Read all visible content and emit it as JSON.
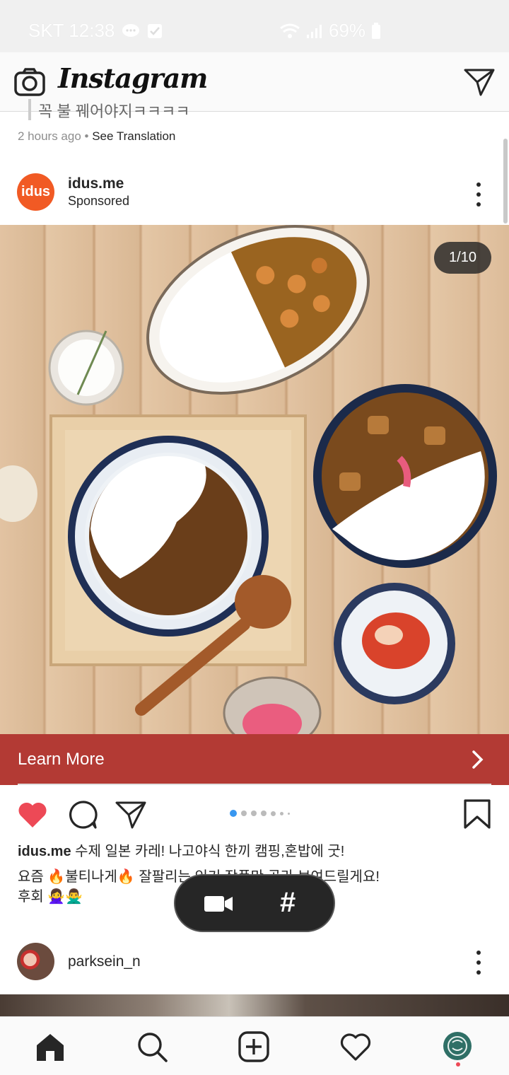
{
  "status_bar": {
    "carrier_time": "SKT 12:38",
    "battery": "69%",
    "icons": [
      "chat-bubble-icon",
      "check-square-icon",
      "wifi-icon",
      "signal-icon",
      "battery-icon"
    ]
  },
  "topbar": {
    "title": "Instagram",
    "camera_icon": "camera-icon",
    "direct_icon": "paper-plane-icon"
  },
  "previous_post": {
    "caption_partial": "꼭 불 꿰어야지ㅋㅋㅋㅋ",
    "time": "2 hours ago",
    "separator": "•",
    "see_translation": "See Translation"
  },
  "post": {
    "avatar_text": "idus",
    "username": "idus.me",
    "subtitle": "Sponsored",
    "counter": "1/10",
    "cta_label": "Learn More",
    "carousel_active_index": 0,
    "carousel_dot_count": 7,
    "caption": {
      "username": "idus.me",
      "line1": "수제 일본 카레!  나고야식 한끼 캠핑,혼밥에 굿!",
      "line2": "요즘 🔥불티나게🔥 잘팔리는 인기 작품만 골라 보여드릴게요!",
      "line3": "후회 🙅‍♀️🙅‍♂️"
    }
  },
  "floating_toolbar": {
    "video_icon": "video-camera-icon",
    "hashtag": "#"
  },
  "next_post": {
    "username": "parksein_n"
  },
  "bottom_nav": {
    "items": [
      "home-icon",
      "search-icon",
      "add-post-icon",
      "activity-heart-icon",
      "profile-avatar"
    ]
  },
  "colors": {
    "like_red": "#ed4956",
    "cta_bg": "#b33a34",
    "carousel_active": "#3897f0",
    "brand_orange": "#f15a24"
  }
}
